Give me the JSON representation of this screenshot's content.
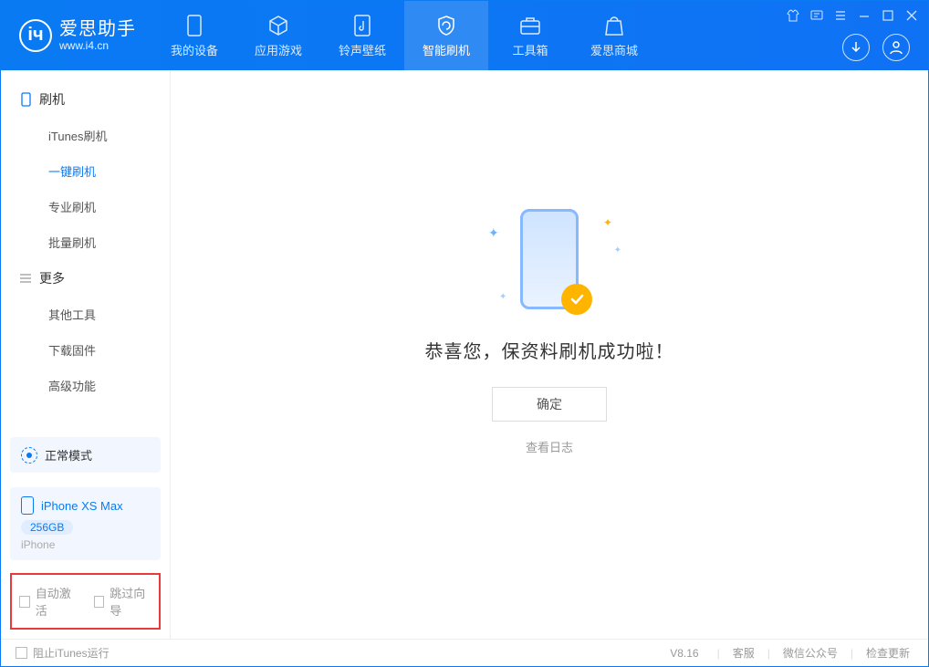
{
  "app": {
    "name_cn": "爱思助手",
    "name_en": "www.i4.cn"
  },
  "nav": {
    "my_device": "我的设备",
    "apps_games": "应用游戏",
    "ring_wallpaper": "铃声壁纸",
    "smart_flash": "智能刷机",
    "toolbox": "工具箱",
    "store": "爱思商城"
  },
  "sidebar": {
    "group_flash": "刷机",
    "items_flash": {
      "itunes": "iTunes刷机",
      "onekey": "一键刷机",
      "pro": "专业刷机",
      "batch": "批量刷机"
    },
    "group_more": "更多",
    "items_more": {
      "other_tools": "其他工具",
      "download_fw": "下载固件",
      "advanced": "高级功能"
    }
  },
  "mode": {
    "label": "正常模式"
  },
  "device": {
    "name": "iPhone XS Max",
    "storage": "256GB",
    "type": "iPhone"
  },
  "bottom_options": {
    "auto_activate": "自动激活",
    "skip_guide": "跳过向导"
  },
  "main": {
    "success_text": "恭喜您，保资料刷机成功啦！",
    "ok_button": "确定",
    "view_log": "查看日志"
  },
  "footer": {
    "prevent_itunes": "阻止iTunes运行",
    "version": "V8.16",
    "support": "客服",
    "wechat": "微信公众号",
    "check_update": "检查更新"
  }
}
